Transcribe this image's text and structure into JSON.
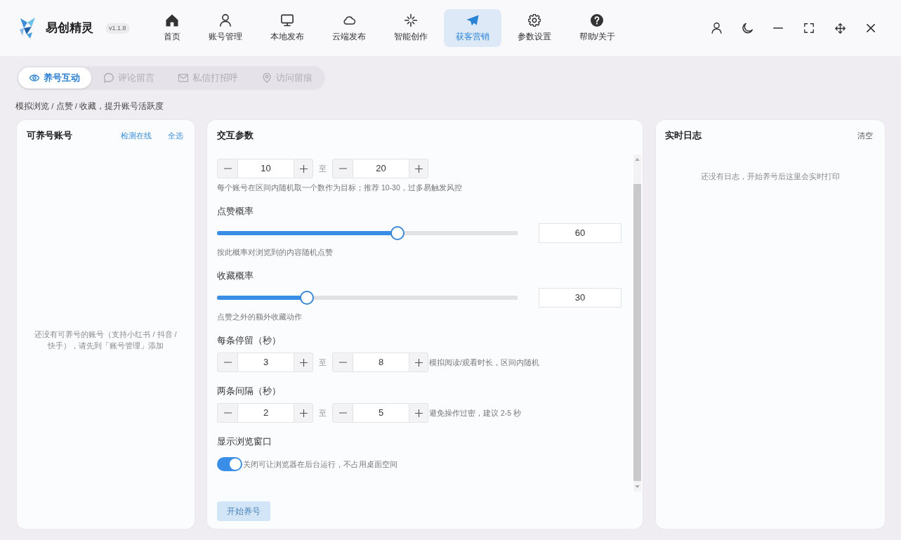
{
  "app": {
    "name": "易创精灵",
    "version": "v1.1.8"
  },
  "nav": [
    {
      "label": "首页",
      "selected": false
    },
    {
      "label": "账号管理",
      "selected": false
    },
    {
      "label": "本地发布",
      "selected": false
    },
    {
      "label": "云端发布",
      "selected": false
    },
    {
      "label": "智能创作",
      "selected": false
    },
    {
      "label": "获客营销",
      "selected": true
    },
    {
      "label": "参数设置",
      "selected": false
    },
    {
      "label": "帮助/关于",
      "selected": false
    }
  ],
  "subtabs": [
    {
      "label": "养号互动",
      "selected": true
    },
    {
      "label": "评论留言",
      "selected": false
    },
    {
      "label": "私信打招呼",
      "selected": false
    },
    {
      "label": "访问留痕",
      "selected": false
    }
  ],
  "subtitle": "模拟浏览 / 点赞 / 收藏，提升账号活跃度",
  "accounts_panel": {
    "title": "可养号账号",
    "actions": [
      "检测在线",
      "全选"
    ],
    "empty_text": "还没有可养号的账号（支持小红书 / 抖音 / 快手），请先到「账号管理」添加"
  },
  "params_panel": {
    "title": "交互参数",
    "fields": [
      {
        "kind": "range",
        "from": "10",
        "separator": "至",
        "to": "20",
        "hint": "每个账号在区间内随机取一个数作为目标；推荐 10-30，过多易触发风控"
      },
      {
        "kind": "slider",
        "label": "点赞概率",
        "level": 0.6,
        "value": "60",
        "hint": "按此概率对浏览到的内容随机点赞"
      },
      {
        "kind": "slider",
        "label": "收藏概率",
        "level": 0.3,
        "value": "30",
        "hint": "点赞之外的额外收藏动作"
      },
      {
        "kind": "range",
        "label": "每条停留（秒）",
        "from": "3",
        "separator": "至",
        "to": "8",
        "side_hint": "模拟阅读/观看时长，区间内随机"
      },
      {
        "kind": "range",
        "label": "两条间隔（秒）",
        "from": "2",
        "separator": "至",
        "to": "5",
        "side_hint": "避免操作过密，建议 2-5 秒"
      },
      {
        "kind": "toggle",
        "label": "显示浏览窗口",
        "on": true,
        "side_hint": "关闭可让浏览器在后台运行，不占用桌面空间"
      }
    ],
    "start_button": {
      "label": "开始养号",
      "disabled": true
    }
  },
  "log_panel": {
    "title": "实时日志",
    "action": "清空",
    "empty_text": "还没有日志，开始养号后这里会实时打印"
  }
}
